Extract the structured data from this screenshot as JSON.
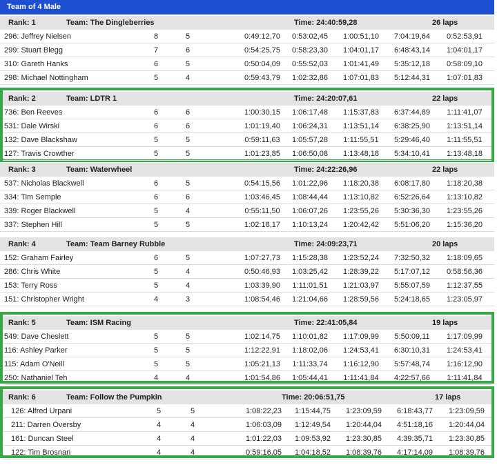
{
  "title": "Team of 4 Male",
  "teams": [
    {
      "rank": "Rank: 1",
      "team": "Team: The Dingleberries",
      "time": "Time: 24:40:59,28",
      "laps": "26 laps",
      "highlight": false,
      "riders": [
        {
          "name": "296: Jeffrey Nielsen",
          "a": "8",
          "b": "5",
          "t1": "0:49:12,70",
          "t2": "0:53:02,45",
          "t3": "1:00:51,10",
          "t4": "7:04:19,64",
          "t5": "0:52:53,91"
        },
        {
          "name": "299: Stuart Blegg",
          "a": "7",
          "b": "6",
          "t1": "0:54:25,75",
          "t2": "0:58:23,30",
          "t3": "1:04:01,17",
          "t4": "6:48:43,14",
          "t5": "1:04:01,17"
        },
        {
          "name": "310: Gareth Hanks",
          "a": "6",
          "b": "5",
          "t1": "0:50:04,09",
          "t2": "0:55:52,03",
          "t3": "1:01:41,49",
          "t4": "5:35:12,18",
          "t5": "0:58:09,10"
        },
        {
          "name": "298: Michael Nottingham",
          "a": "5",
          "b": "4",
          "t1": "0:59:43,79",
          "t2": "1:02:32,86",
          "t3": "1:07:01,83",
          "t4": "5:12:44,31",
          "t5": "1:07:01,83"
        }
      ]
    },
    {
      "rank": "Rank: 2",
      "team": "Team: LDTR 1",
      "time": "Time: 24:20:07,61",
      "laps": "22 laps",
      "highlight": true,
      "riders": [
        {
          "name": "736: Ben Reeves",
          "a": "6",
          "b": "6",
          "t1": "1:00:30,15",
          "t2": "1:06:17,48",
          "t3": "1:15:37,83",
          "t4": "6:37:44,89",
          "t5": "1:11:41,07"
        },
        {
          "name": "531: Dale Wirski",
          "a": "6",
          "b": "6",
          "t1": "1:01:19,40",
          "t2": "1:06:24,31",
          "t3": "1:13:51,14",
          "t4": "6:38:25,90",
          "t5": "1:13:51,14"
        },
        {
          "name": "132: Dave Blackshaw",
          "a": "5",
          "b": "5",
          "t1": "0:59:11,63",
          "t2": "1:05:57,28",
          "t3": "1:11:55,51",
          "t4": "5:29:46,40",
          "t5": "1:11:55,51"
        },
        {
          "name": "127: Travis Crowther",
          "a": "5",
          "b": "5",
          "t1": "1:01:23,85",
          "t2": "1:06:50,08",
          "t3": "1:13:48,18",
          "t4": "5:34:10,41",
          "t5": "1:13:48,18"
        }
      ]
    },
    {
      "rank": "Rank: 3",
      "team": "Team: Waterwheel",
      "time": "Time: 24:22:26,96",
      "laps": "22 laps",
      "highlight": false,
      "riders": [
        {
          "name": "537: Nicholas Blackwell",
          "a": "6",
          "b": "5",
          "t1": "0:54:15,56",
          "t2": "1:01:22,96",
          "t3": "1:18:20,38",
          "t4": "6:08:17,80",
          "t5": "1:18:20,38"
        },
        {
          "name": "334: Tim Semple",
          "a": "6",
          "b": "6",
          "t1": "1:03:46,45",
          "t2": "1:08:44,44",
          "t3": "1:13:10,82",
          "t4": "6:52:26,64",
          "t5": "1:13:10,82"
        },
        {
          "name": "339: Roger Blackwell",
          "a": "5",
          "b": "4",
          "t1": "0:55:11,50",
          "t2": "1:06:07,26",
          "t3": "1:23:55,26",
          "t4": "5:30:36,30",
          "t5": "1:23:55,26"
        },
        {
          "name": "337: Stephen Hill",
          "a": "5",
          "b": "5",
          "t1": "1:02:18,17",
          "t2": "1:10:13,24",
          "t3": "1:20:42,42",
          "t4": "5:51:06,20",
          "t5": "1:15:36,20"
        }
      ]
    },
    {
      "rank": "Rank: 4",
      "team": "Team: Team Barney Rubble",
      "time": "Time: 24:09:23,71",
      "laps": "20 laps",
      "highlight": false,
      "riders": [
        {
          "name": "152: Graham Fairley",
          "a": "6",
          "b": "5",
          "t1": "1:07:27,73",
          "t2": "1:15:28,38",
          "t3": "1:23:52,24",
          "t4": "7:32:50,32",
          "t5": "1:18:09,65"
        },
        {
          "name": "286: Chris White",
          "a": "5",
          "b": "4",
          "t1": "0:50:46,93",
          "t2": "1:03:25,42",
          "t3": "1:28:39,22",
          "t4": "5:17:07,12",
          "t5": "0:58:56,36"
        },
        {
          "name": "153: Terry Ross",
          "a": "5",
          "b": "4",
          "t1": "1:03:39,90",
          "t2": "1:11:01,51",
          "t3": "1:21:03,97",
          "t4": "5:55:07,59",
          "t5": "1:12:37,55"
        },
        {
          "name": "151: Christopher Wright",
          "a": "4",
          "b": "3",
          "t1": "1:08:54,46",
          "t2": "1:21:04,66",
          "t3": "1:28:59,56",
          "t4": "5:24:18,65",
          "t5": "1:23:05,97"
        }
      ]
    },
    {
      "rank": "Rank: 5",
      "team": "Team: ISM Racing",
      "time": "Time: 22:41:05,84",
      "laps": "19 laps",
      "highlight": true,
      "riders": [
        {
          "name": "549: Dave Cheslett",
          "a": "5",
          "b": "5",
          "t1": "1:02:14,75",
          "t2": "1:10:01,82",
          "t3": "1:17:09,99",
          "t4": "5:50:09,11",
          "t5": "1:17:09,99"
        },
        {
          "name": "116: Ashley Parker",
          "a": "5",
          "b": "5",
          "t1": "1:12:22,91",
          "t2": "1:18:02,06",
          "t3": "1:24:53,41",
          "t4": "6:30:10,31",
          "t5": "1:24:53,41"
        },
        {
          "name": "115: Adam O'Neill",
          "a": "5",
          "b": "5",
          "t1": "1:05:21,13",
          "t2": "1:11:33,74",
          "t3": "1:16:12,90",
          "t4": "5:57:48,74",
          "t5": "1:16:12,90"
        },
        {
          "name": "250: Nathaniel Teh",
          "a": "4",
          "b": "4",
          "t1": "1:01:54,86",
          "t2": "1:05:44,41",
          "t3": "1:11:41,84",
          "t4": "4:22:57,66",
          "t5": "1:11:41,84"
        }
      ]
    },
    {
      "rank": "Rank: 6",
      "team": "Team: Follow the Pumpkin",
      "time": "Time: 20:06:51,75",
      "laps": "17 laps",
      "highlight": true,
      "riders": [
        {
          "name": "126: Alfred Urpani",
          "a": "5",
          "b": "5",
          "t1": "1:08:22,23",
          "t2": "1:15:44,75",
          "t3": "1:23:09,59",
          "t4": "6:18:43,77",
          "t5": "1:23:09,59"
        },
        {
          "name": "211: Darren Oversby",
          "a": "4",
          "b": "4",
          "t1": "1:06:03,09",
          "t2": "1:12:49,54",
          "t3": "1:20:44,04",
          "t4": "4:51:18,16",
          "t5": "1:20:44,04"
        },
        {
          "name": "161: Duncan Steel",
          "a": "4",
          "b": "4",
          "t1": "1:01:22,03",
          "t2": "1:09:53,92",
          "t3": "1:23:30,85",
          "t4": "4:39:35,71",
          "t5": "1:23:30,85"
        },
        {
          "name": "122: Tim Brosnan",
          "a": "4",
          "b": "4",
          "t1": "0:59:16,05",
          "t2": "1:04:18,52",
          "t3": "1:08:39,76",
          "t4": "4:17:14,09",
          "t5": "1:08:39,76"
        }
      ]
    }
  ]
}
